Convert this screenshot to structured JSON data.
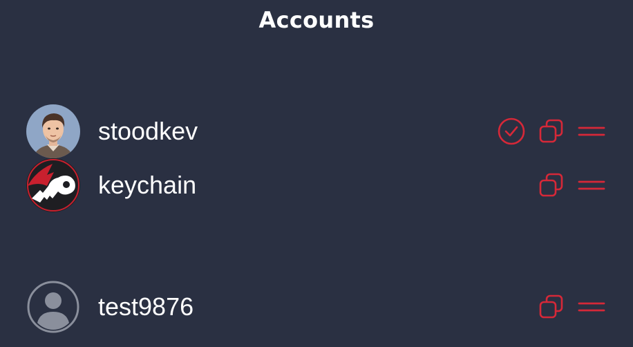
{
  "header": {
    "title": "Accounts"
  },
  "colors": {
    "accent": "#d62838",
    "background": "#2a3042"
  },
  "accounts": [
    {
      "name": "stoodkev",
      "avatar": "person-photo",
      "active": true
    },
    {
      "name": "keychain",
      "avatar": "keychain-logo",
      "active": false
    },
    {
      "name": "test9876",
      "avatar": "default-user-icon",
      "active": false
    }
  ]
}
